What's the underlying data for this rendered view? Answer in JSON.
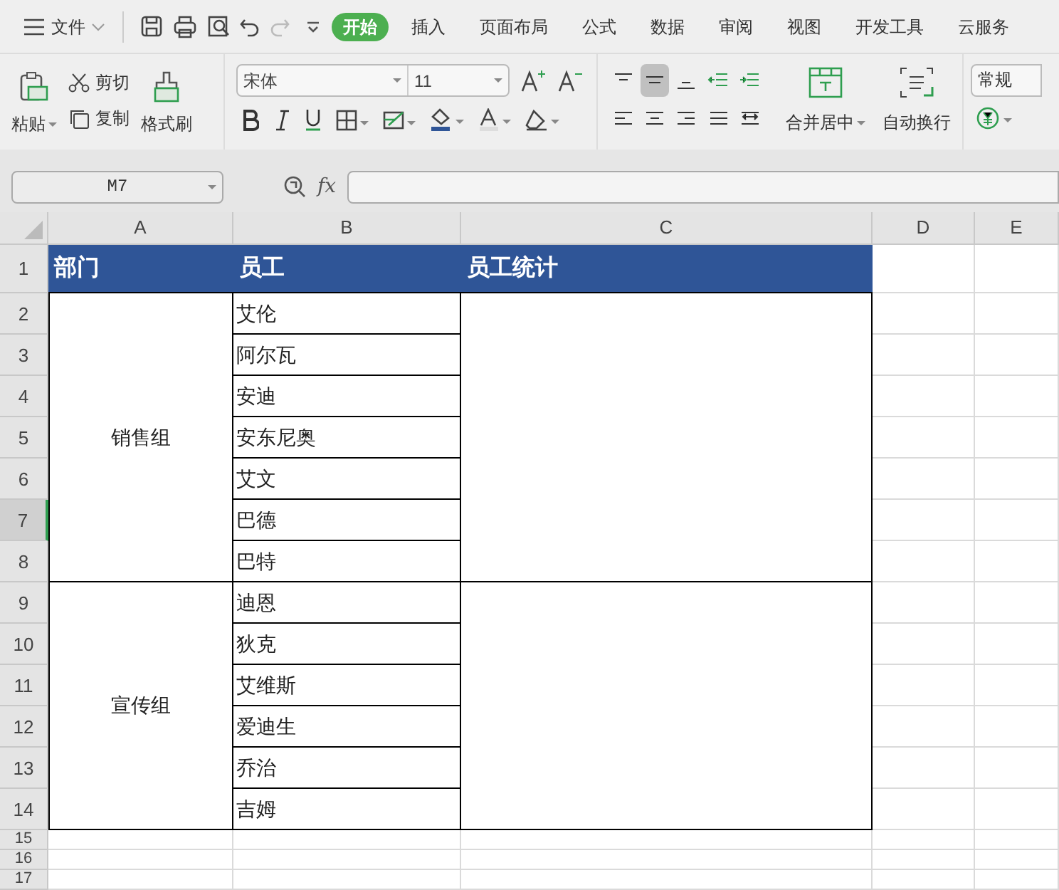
{
  "menu": {
    "label": "文件"
  },
  "tabs": [
    {
      "label": "开始",
      "selected": true
    },
    {
      "label": "插入",
      "selected": false
    },
    {
      "label": "页面布局",
      "selected": false
    },
    {
      "label": "公式",
      "selected": false
    },
    {
      "label": "数据",
      "selected": false
    },
    {
      "label": "审阅",
      "selected": false
    },
    {
      "label": "视图",
      "selected": false
    },
    {
      "label": "开发工具",
      "selected": false
    },
    {
      "label": "云服务",
      "selected": false
    }
  ],
  "clipboard": {
    "paste": "粘贴",
    "cut": "剪切",
    "copy": "复制",
    "format_painter": "格式刷"
  },
  "font": {
    "name": "宋体",
    "size": "11"
  },
  "align_buttons": [
    {
      "selected": false
    },
    {
      "selected": true
    },
    {
      "selected": false
    },
    {
      "selected": false
    },
    {
      "selected": false
    },
    {
      "selected": false
    },
    {
      "selected": false
    },
    {
      "selected": false
    },
    {
      "selected": false
    },
    {
      "selected": false
    }
  ],
  "merge_label": "合并居中",
  "wrap_label": "自动换行",
  "number_format": "常规",
  "name_box": "M7",
  "fx": "fx",
  "columns": [
    "A",
    "B",
    "C",
    "D",
    "E"
  ],
  "rows": [
    {
      "label": "1",
      "selected": false
    },
    {
      "label": "2",
      "selected": false
    },
    {
      "label": "3",
      "selected": false
    },
    {
      "label": "4",
      "selected": false
    },
    {
      "label": "5",
      "selected": false
    },
    {
      "label": "6",
      "selected": false
    },
    {
      "label": "7",
      "selected": true
    },
    {
      "label": "8",
      "selected": false
    },
    {
      "label": "9",
      "selected": false
    },
    {
      "label": "10",
      "selected": false
    },
    {
      "label": "11",
      "selected": false
    },
    {
      "label": "12",
      "selected": false
    },
    {
      "label": "13",
      "selected": false
    },
    {
      "label": "14",
      "selected": false
    },
    {
      "label": "15",
      "selected": false
    },
    {
      "label": "16",
      "selected": false
    },
    {
      "label": "17",
      "selected": false
    }
  ],
  "header": [
    "部门",
    "员工",
    "员工统计"
  ],
  "groups": [
    {
      "department": "销售组",
      "employees": [
        "艾伦",
        "阿尔瓦",
        "安迪",
        "安东尼奥",
        "艾文",
        "巴德",
        "巴特"
      ]
    },
    {
      "department": "宣传组",
      "employees": [
        "迪恩",
        "狄克",
        "艾维斯",
        "爱迪生",
        "乔治",
        "吉姆"
      ]
    }
  ]
}
